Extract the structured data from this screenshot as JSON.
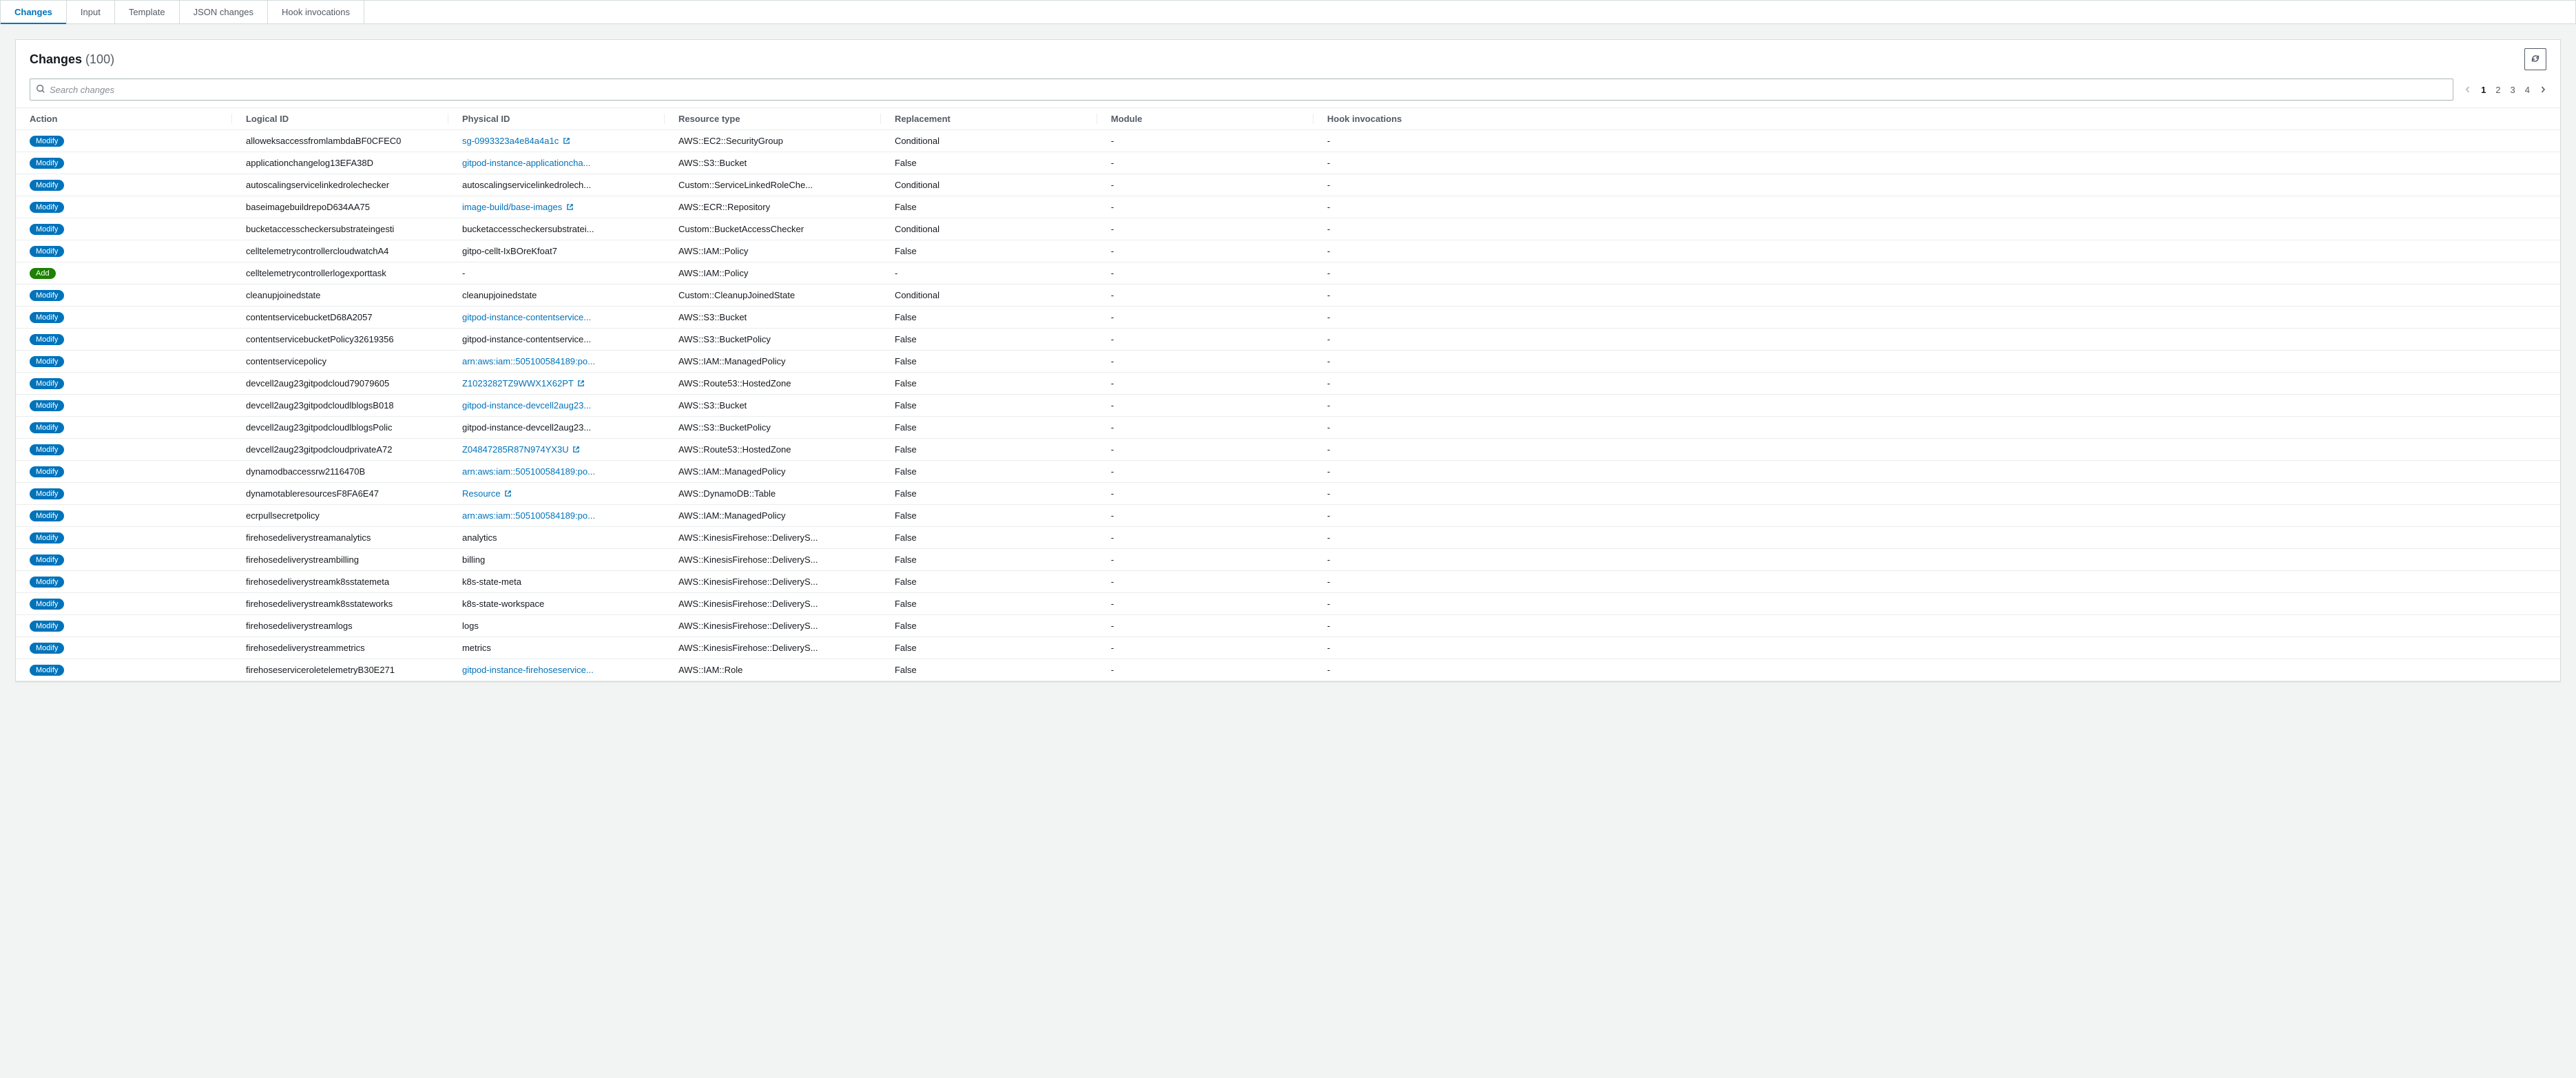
{
  "tabs": {
    "changes": "Changes",
    "input": "Input",
    "template": "Template",
    "json_changes": "JSON changes",
    "hook_invocations": "Hook invocations"
  },
  "panel": {
    "title": "Changes",
    "count": "(100)"
  },
  "search": {
    "placeholder": "Search changes"
  },
  "pagination": {
    "pages": [
      "1",
      "2",
      "3",
      "4"
    ],
    "active": 0
  },
  "columns": {
    "action": "Action",
    "logical_id": "Logical ID",
    "physical_id": "Physical ID",
    "resource_type": "Resource type",
    "replacement": "Replacement",
    "module": "Module",
    "hook_invocations": "Hook invocations"
  },
  "action_labels": {
    "modify": "Modify",
    "add": "Add"
  },
  "rows": [
    {
      "action": "modify",
      "logical_id": "alloweksaccessfromlambdaBF0CFEC0",
      "physical_id": "sg-0993323a4e84a4a1c",
      "physical_is_link": true,
      "physical_ext": true,
      "resource_type": "AWS::EC2::SecurityGroup",
      "replacement": "Conditional",
      "module": "-",
      "hook": "-"
    },
    {
      "action": "modify",
      "logical_id": "applicationchangelog13EFA38D",
      "physical_id": "gitpod-instance-applicationcha...",
      "physical_is_link": true,
      "physical_ext": false,
      "resource_type": "AWS::S3::Bucket",
      "replacement": "False",
      "module": "-",
      "hook": "-"
    },
    {
      "action": "modify",
      "logical_id": "autoscalingservicelinkedrolechecker",
      "physical_id": "autoscalingservicelinkedrolech...",
      "physical_is_link": false,
      "physical_ext": false,
      "resource_type": "Custom::ServiceLinkedRoleChe...",
      "replacement": "Conditional",
      "module": "-",
      "hook": "-"
    },
    {
      "action": "modify",
      "logical_id": "baseimagebuildrepoD634AA75",
      "physical_id": "image-build/base-images",
      "physical_is_link": true,
      "physical_ext": true,
      "resource_type": "AWS::ECR::Repository",
      "replacement": "False",
      "module": "-",
      "hook": "-"
    },
    {
      "action": "modify",
      "logical_id": "bucketaccesscheckersubstrateingesti",
      "physical_id": "bucketaccesscheckersubstratei...",
      "physical_is_link": false,
      "physical_ext": false,
      "resource_type": "Custom::BucketAccessChecker",
      "replacement": "Conditional",
      "module": "-",
      "hook": "-"
    },
    {
      "action": "modify",
      "logical_id": "celltelemetrycontrollercloudwatchA4",
      "physical_id": "gitpo-cellt-IxBOreKfoat7",
      "physical_is_link": false,
      "physical_ext": false,
      "resource_type": "AWS::IAM::Policy",
      "replacement": "False",
      "module": "-",
      "hook": "-"
    },
    {
      "action": "add",
      "logical_id": "celltelemetrycontrollerlogexporttask",
      "physical_id": "-",
      "physical_is_link": false,
      "physical_ext": false,
      "resource_type": "AWS::IAM::Policy",
      "replacement": "-",
      "module": "-",
      "hook": "-"
    },
    {
      "action": "modify",
      "logical_id": "cleanupjoinedstate",
      "physical_id": "cleanupjoinedstate",
      "physical_is_link": false,
      "physical_ext": false,
      "resource_type": "Custom::CleanupJoinedState",
      "replacement": "Conditional",
      "module": "-",
      "hook": "-"
    },
    {
      "action": "modify",
      "logical_id": "contentservicebucketD68A2057",
      "physical_id": "gitpod-instance-contentservice...",
      "physical_is_link": true,
      "physical_ext": false,
      "resource_type": "AWS::S3::Bucket",
      "replacement": "False",
      "module": "-",
      "hook": "-"
    },
    {
      "action": "modify",
      "logical_id": "contentservicebucketPolicy32619356",
      "physical_id": "gitpod-instance-contentservice...",
      "physical_is_link": false,
      "physical_ext": false,
      "resource_type": "AWS::S3::BucketPolicy",
      "replacement": "False",
      "module": "-",
      "hook": "-"
    },
    {
      "action": "modify",
      "logical_id": "contentservicepolicy",
      "physical_id": "arn:aws:iam::505100584189:po...",
      "physical_is_link": true,
      "physical_ext": false,
      "resource_type": "AWS::IAM::ManagedPolicy",
      "replacement": "False",
      "module": "-",
      "hook": "-"
    },
    {
      "action": "modify",
      "logical_id": "devcell2aug23gitpodcloud79079605",
      "physical_id": "Z1023282TZ9WWX1X62PT",
      "physical_is_link": true,
      "physical_ext": true,
      "resource_type": "AWS::Route53::HostedZone",
      "replacement": "False",
      "module": "-",
      "hook": "-"
    },
    {
      "action": "modify",
      "logical_id": "devcell2aug23gitpodcloudlblogsB018",
      "physical_id": "gitpod-instance-devcell2aug23...",
      "physical_is_link": true,
      "physical_ext": false,
      "resource_type": "AWS::S3::Bucket",
      "replacement": "False",
      "module": "-",
      "hook": "-"
    },
    {
      "action": "modify",
      "logical_id": "devcell2aug23gitpodcloudlblogsPolic",
      "physical_id": "gitpod-instance-devcell2aug23...",
      "physical_is_link": false,
      "physical_ext": false,
      "resource_type": "AWS::S3::BucketPolicy",
      "replacement": "False",
      "module": "-",
      "hook": "-"
    },
    {
      "action": "modify",
      "logical_id": "devcell2aug23gitpodcloudprivateA72",
      "physical_id": "Z04847285R87N974YX3U",
      "physical_is_link": true,
      "physical_ext": true,
      "resource_type": "AWS::Route53::HostedZone",
      "replacement": "False",
      "module": "-",
      "hook": "-"
    },
    {
      "action": "modify",
      "logical_id": "dynamodbaccessrw2116470B",
      "physical_id": "arn:aws:iam::505100584189:po...",
      "physical_is_link": true,
      "physical_ext": false,
      "resource_type": "AWS::IAM::ManagedPolicy",
      "replacement": "False",
      "module": "-",
      "hook": "-"
    },
    {
      "action": "modify",
      "logical_id": "dynamotableresourcesF8FA6E47",
      "physical_id": "Resource",
      "physical_is_link": true,
      "physical_ext": true,
      "resource_type": "AWS::DynamoDB::Table",
      "replacement": "False",
      "module": "-",
      "hook": "-"
    },
    {
      "action": "modify",
      "logical_id": "ecrpullsecretpolicy",
      "physical_id": "arn:aws:iam::505100584189:po...",
      "physical_is_link": true,
      "physical_ext": false,
      "resource_type": "AWS::IAM::ManagedPolicy",
      "replacement": "False",
      "module": "-",
      "hook": "-"
    },
    {
      "action": "modify",
      "logical_id": "firehosedeliverystreamanalytics",
      "physical_id": "analytics",
      "physical_is_link": false,
      "physical_ext": false,
      "resource_type": "AWS::KinesisFirehose::DeliveryS...",
      "replacement": "False",
      "module": "-",
      "hook": "-"
    },
    {
      "action": "modify",
      "logical_id": "firehosedeliverystreambilling",
      "physical_id": "billing",
      "physical_is_link": false,
      "physical_ext": false,
      "resource_type": "AWS::KinesisFirehose::DeliveryS...",
      "replacement": "False",
      "module": "-",
      "hook": "-"
    },
    {
      "action": "modify",
      "logical_id": "firehosedeliverystreamk8sstatemeta",
      "physical_id": "k8s-state-meta",
      "physical_is_link": false,
      "physical_ext": false,
      "resource_type": "AWS::KinesisFirehose::DeliveryS...",
      "replacement": "False",
      "module": "-",
      "hook": "-"
    },
    {
      "action": "modify",
      "logical_id": "firehosedeliverystreamk8sstateworks",
      "physical_id": "k8s-state-workspace",
      "physical_is_link": false,
      "physical_ext": false,
      "resource_type": "AWS::KinesisFirehose::DeliveryS...",
      "replacement": "False",
      "module": "-",
      "hook": "-"
    },
    {
      "action": "modify",
      "logical_id": "firehosedeliverystreamlogs",
      "physical_id": "logs",
      "physical_is_link": false,
      "physical_ext": false,
      "resource_type": "AWS::KinesisFirehose::DeliveryS...",
      "replacement": "False",
      "module": "-",
      "hook": "-"
    },
    {
      "action": "modify",
      "logical_id": "firehosedeliverystreammetrics",
      "physical_id": "metrics",
      "physical_is_link": false,
      "physical_ext": false,
      "resource_type": "AWS::KinesisFirehose::DeliveryS...",
      "replacement": "False",
      "module": "-",
      "hook": "-"
    },
    {
      "action": "modify",
      "logical_id": "firehoseserviceroletelemetryB30E271",
      "physical_id": "gitpod-instance-firehoseservice...",
      "physical_is_link": true,
      "physical_ext": false,
      "resource_type": "AWS::IAM::Role",
      "replacement": "False",
      "module": "-",
      "hook": "-"
    }
  ]
}
